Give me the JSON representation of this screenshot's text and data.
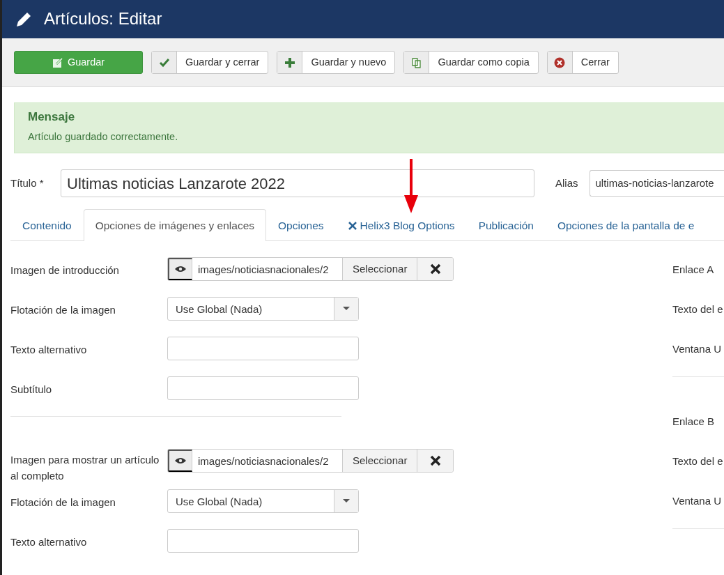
{
  "header": {
    "title": "Artículos: Editar"
  },
  "toolbar": [
    {
      "kind": "save",
      "label": "Guardar"
    },
    {
      "kind": "apply",
      "label": "Guardar y cerrar"
    },
    {
      "kind": "new",
      "label": "Guardar y nuevo"
    },
    {
      "kind": "copy",
      "label": "Guardar como copia"
    },
    {
      "kind": "cancel",
      "label": "Cerrar"
    }
  ],
  "message": {
    "heading": "Mensaje",
    "text": "Artículo guardado correctamente."
  },
  "title_field": {
    "label": "Título *",
    "value": "Ultimas noticias Lanzarote 2022"
  },
  "alias_field": {
    "label": "Alias",
    "value": "ultimas-noticias-lanzarote"
  },
  "tabs": [
    {
      "kind": "plain",
      "label": "Contenido",
      "selected": false
    },
    {
      "kind": "plain",
      "label": "Opciones de imágenes y enlaces",
      "selected": true
    },
    {
      "kind": "plain",
      "label": "Opciones",
      "selected": false
    },
    {
      "kind": "plugin",
      "label": "Helix3 Blog Options",
      "selected": false
    },
    {
      "kind": "plain",
      "label": "Publicación",
      "selected": false
    },
    {
      "kind": "plain",
      "label": "Opciones de la pantalla de e",
      "selected": false
    }
  ],
  "left_fields": [
    {
      "kind": "media",
      "label": "Imagen de introducción",
      "value": "images/noticiasnacionales/2",
      "button": "Seleccionar"
    },
    {
      "kind": "select",
      "label": "Flotación de la imagen",
      "value": "Use Global (Nada)"
    },
    {
      "kind": "text",
      "label": "Texto alternativo"
    },
    {
      "kind": "text",
      "label": "Subtítulo"
    },
    {
      "kind": "divider"
    },
    {
      "kind": "media",
      "label": "Imagen para mostrar un artículo al completo",
      "value": "images/noticiasnacionales/2",
      "button": "Seleccionar"
    },
    {
      "kind": "select",
      "label": "Flotación de la imagen",
      "value": "Use Global (Nada)"
    },
    {
      "kind": "text",
      "label": "Texto alternativo"
    }
  ],
  "right_fields": [
    {
      "kind": "label",
      "label": "Enlace A"
    },
    {
      "kind": "label",
      "label": "Texto del e"
    },
    {
      "kind": "label",
      "label": "Ventana U"
    },
    {
      "kind": "divider"
    },
    {
      "kind": "label",
      "label": "Enlace B"
    },
    {
      "kind": "label",
      "label": "Texto del e"
    },
    {
      "kind": "label",
      "label": "Ventana U"
    },
    {
      "kind": "divider"
    }
  ]
}
